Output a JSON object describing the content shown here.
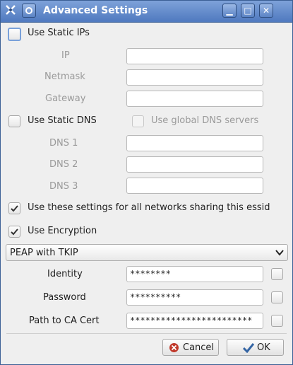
{
  "window": {
    "title": "Advanced Settings",
    "minimize_glyph": "▁",
    "maximize_glyph": "□",
    "close_glyph": "✕"
  },
  "static_ips": {
    "label": "Use Static IPs",
    "checked": false,
    "ip_label": "IP",
    "netmask_label": "Netmask",
    "gateway_label": "Gateway",
    "ip_value": "",
    "netmask_value": "",
    "gateway_value": ""
  },
  "static_dns": {
    "label": "Use Static DNS",
    "global_label": "Use global DNS servers",
    "dns1_label": "DNS 1",
    "dns2_label": "DNS 2",
    "dns3_label": "DNS 3",
    "dns1_value": "",
    "dns2_value": "",
    "dns3_value": ""
  },
  "all_networks": {
    "label": "Use these settings for all networks sharing this essid",
    "checked": true
  },
  "encryption": {
    "label": "Use Encryption",
    "checked": true,
    "type": "PEAP with TKIP",
    "identity_label": "Identity",
    "identity_value": "********",
    "password_label": "Password",
    "password_value": "**********",
    "ca_cert_label": "Path to CA Cert",
    "ca_cert_value": "************************"
  },
  "buttons": {
    "cancel_label": "Cancel",
    "ok_label": "OK"
  },
  "colors": {
    "titlebar": "#5a82c4",
    "accent": "#7aa1da",
    "cancel_icon": "#c0392b",
    "ok_icon": "#3465a4"
  }
}
